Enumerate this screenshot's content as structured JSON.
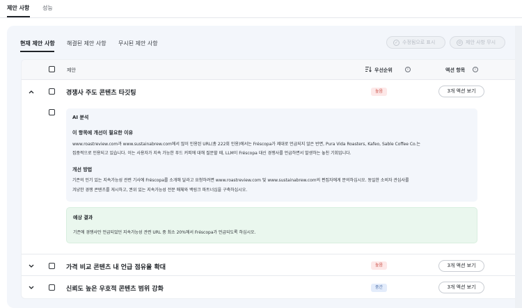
{
  "top_tabs": {
    "suggestions": "제안 사항",
    "performance": "성능"
  },
  "sub_tabs": {
    "current": "현재 제안 사항",
    "resolved": "해결된 제안 사항",
    "ignored": "무시된 제안 사항"
  },
  "header_buttons": {
    "mark_fixed": "수정됨으로 표시",
    "ignore": "제안 사항 무시"
  },
  "table_header": {
    "suggestion": "제안",
    "priority": "우선순위",
    "actions": "액션 항목"
  },
  "rows": [
    {
      "title": "경쟁사 주도 콘텐츠 타깃팅",
      "priority": "높음",
      "action": "3개 액션 보기",
      "expanded": true
    },
    {
      "title": "가격 비교 콘텐츠 내 언급 점유율 확대",
      "priority": "높음",
      "action": "3개 액션 보기",
      "expanded": false
    },
    {
      "title": "신뢰도 높은 우호적 콘텐츠 범위 강화",
      "priority": "중간",
      "action": "3개 액션 보기",
      "expanded": false
    }
  ],
  "ai_analysis": {
    "title": "AI 분석",
    "why_title": "이 항목에 개선이 필요한 이유",
    "why_text_1": "www.roastreview.com과 www.sustainabrew.com에서 많이 인용된 URL(총 222회 인용)에서는 Fréscopa가 제대로 언급되지 않은 반면, Pura Vida Roasters, Kafeo, Sable Coffee Co.는",
    "why_text_2": "집중적으로 인용되고 있습니다. 이는 사용자가 지속 가능한 푸드 커피에 대해 질문할 때, LLM이 Fréscopa 대신 경쟁사를 언급하면서 발생하는 놓친 기회입니다.",
    "how_title": "개선 방법",
    "how_text_1": "기존의 인기 있는 지속가능성 관련 기사에 Fréscopa를 소개해 달라고 요청하려면 www.roastreview.com 및 www.sustainabrew.com의 편집자에게 문의하십시오. 동일한 소비자 관심사를",
    "how_text_2": "겨냥한 경쟁 콘텐츠를 게시하고, 권위 있는 지속가능성 전문 매체와 백링크 파트너십을 구축하십시오.",
    "result_title": "예상 결과",
    "result_text": "기존에 경쟁사만 언급되었던 지속가능성 관련 URL 중 최소 20%에서 Fréscopa가 언급되도록 하십시오."
  },
  "colors": {
    "accent": "#1f2328",
    "panel_bg": "#f3f6fb",
    "high_badge": "#fde8e8",
    "mid_badge": "#e3ecfb",
    "result_bg": "#eaf7ee"
  },
  "icons": {
    "sort": "sort-desc-icon",
    "info": "info-icon",
    "chevron_up": "chevron-up-icon",
    "chevron_down": "chevron-down-icon"
  }
}
